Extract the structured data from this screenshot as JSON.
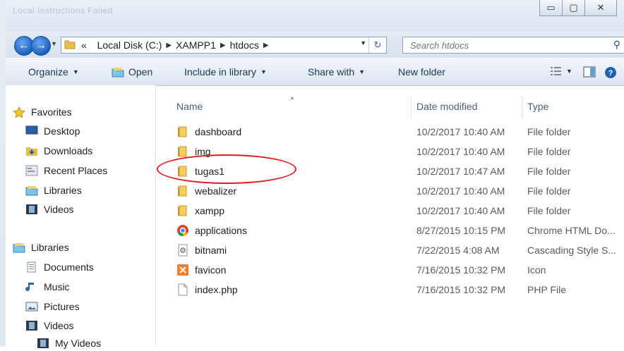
{
  "window": {
    "ghost_title": "Local Instructions Failed",
    "controls": {
      "minimize": "▭",
      "maximize": "▢",
      "close": "✕"
    }
  },
  "nav": {
    "breadcrumbs": [
      "Local Disk (C:)",
      "XAMPP1",
      "htdocs"
    ],
    "overflow": "«",
    "search_placeholder": "Search htdocs"
  },
  "toolbar": {
    "organize": "Organize",
    "open": "Open",
    "include_in_library": "Include in library",
    "share_with": "Share with",
    "new_folder": "New folder"
  },
  "sidebar": {
    "favorites_header": "Favorites",
    "favorites": [
      "Desktop",
      "Downloads",
      "Recent Places",
      "Libraries",
      "Videos"
    ],
    "libraries_header": "Libraries",
    "libraries": [
      "Documents",
      "Music",
      "Pictures",
      "Videos",
      "My Videos"
    ]
  },
  "columns": {
    "name": "Name",
    "date": "Date modified",
    "type": "Type"
  },
  "files": [
    {
      "name": "dashboard",
      "date": "10/2/2017 10:40 AM",
      "type": "File folder",
      "icon": "folder-icon"
    },
    {
      "name": "img",
      "date": "10/2/2017 10:40 AM",
      "type": "File folder",
      "icon": "folder-icon"
    },
    {
      "name": "tugas1",
      "date": "10/2/2017 10:47 AM",
      "type": "File folder",
      "icon": "folder-icon",
      "highlighted": true
    },
    {
      "name": "webalizer",
      "date": "10/2/2017 10:40 AM",
      "type": "File folder",
      "icon": "folder-icon"
    },
    {
      "name": "xampp",
      "date": "10/2/2017 10:40 AM",
      "type": "File folder",
      "icon": "folder-icon"
    },
    {
      "name": "applications",
      "date": "8/27/2015 10:15 PM",
      "type": "Chrome HTML Do...",
      "icon": "chrome-icon"
    },
    {
      "name": "bitnami",
      "date": "7/22/2015 4:08 AM",
      "type": "Cascading Style S...",
      "icon": "css-file-icon"
    },
    {
      "name": "favicon",
      "date": "7/16/2015 10:32 PM",
      "type": "Icon",
      "icon": "xampp-icon"
    },
    {
      "name": "index.php",
      "date": "7/16/2015 10:32 PM",
      "type": "PHP File",
      "icon": "blank-file-icon"
    }
  ],
  "colors": {
    "highlight_ring": "#e11b22",
    "accent": "#1b5fbf"
  }
}
